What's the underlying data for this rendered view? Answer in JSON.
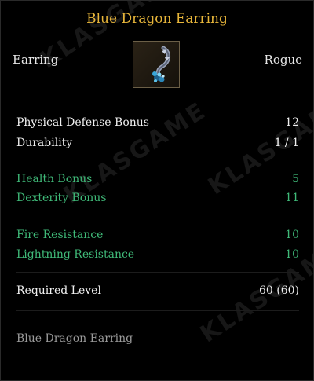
{
  "item": {
    "name": "Blue Dragon Earring",
    "type": "Earring",
    "class": "Rogue",
    "icon": "earring-icon",
    "description": "Blue Dragon Earring"
  },
  "base_stats": [
    {
      "label": "Physical Defense Bonus",
      "value": "12"
    },
    {
      "label": "Durability",
      "value": "1 / 1"
    }
  ],
  "bonus_stats": [
    {
      "label": "Health Bonus",
      "value": "5"
    },
    {
      "label": "Dexterity Bonus",
      "value": "11"
    }
  ],
  "resistances": [
    {
      "label": "Fire Resistance",
      "value": "10"
    },
    {
      "label": "Lightning Resistance",
      "value": "10"
    }
  ],
  "requirement": {
    "label": "Required Level",
    "value": "60 (60)"
  },
  "watermark": "KLASGAME",
  "colors": {
    "title": "#e8b63a",
    "stat_white": "#f0f0f0",
    "stat_green": "#3fb978",
    "description": "#9a9a9a"
  }
}
